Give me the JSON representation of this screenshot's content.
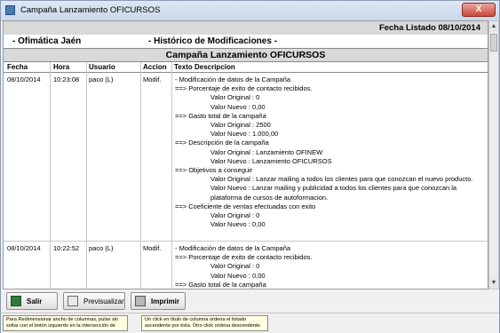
{
  "window": {
    "title": "Campaña Lanzamiento OFICURSOS",
    "close_label": "X"
  },
  "report": {
    "fecha_listado": "Fecha Listado  08/10/2014",
    "empresa": "- Ofimática Jaén",
    "historico": "- Histórico de Modificaciones -",
    "campana": "Campaña Lanzamiento OFICURSOS",
    "columns": [
      "Fecha",
      "Hora",
      "Usuario",
      "Accion",
      "Texto Descripcion"
    ],
    "records": [
      {
        "fecha": "08/10/2014",
        "hora": "10:23:08",
        "usuario": "paco (L)",
        "accion": "Modif.",
        "lines": [
          "- Modificación de datos de la Campaña",
          "==> Porcentaje de exito de contacto recibidos.",
          "Valor Original : 0",
          "Valor Nuevo : 0,00",
          "==> Gasto total de la campaña",
          "Valor Original : 2500",
          "Valor Nuevo : 1.000,00",
          "==> Descripción de la campaña",
          "Valor Original : Lanzamiento OFINEW",
          "Valor Nuevo : Lanzamiento OFICURSOS",
          "==> Objetivos a conseguir",
          "Valor Original : Lanzar mailing a todos los clientes para que conozcan el nuevo producto.",
          "Valor Nuevo : Lanzar mailing y publicidad a todos los clientes para que conozcan la plataforma de cursos de autoformacion.",
          "==> Coeficiente de ventas efectuadas con exito",
          "Valor Original : 0",
          "Valor Nuevo : 0,00"
        ]
      },
      {
        "fecha": "08/10/2014",
        "hora": "10:22:52",
        "usuario": "paco (L)",
        "accion": "Modif.",
        "lines": [
          "- Modificación de datos de la Campaña",
          "==> Porcentaje de exito de contacto recibidos.",
          "Valor Original : 0",
          "Valor Nuevo : 0,00",
          "==> Gasto total de la campaña"
        ]
      }
    ]
  },
  "toolbar": {
    "salir": "Salir",
    "previsualizar": "Previsualizar",
    "imprimir": "Imprimir"
  },
  "status": {
    "tip_left": "Para Redimensionar ancho de columnas, pulse sin soltar con el botón izquierdo en la intersección de éstas.",
    "tip_right": "Un click en título de columna ordena el listado ascendente por ésta. Otro click ordena descendente."
  },
  "colors": {
    "header_grey": "#d9d9d9",
    "tooltip_bg": "#ffffe1",
    "titlebar": "#c9d8ea"
  }
}
